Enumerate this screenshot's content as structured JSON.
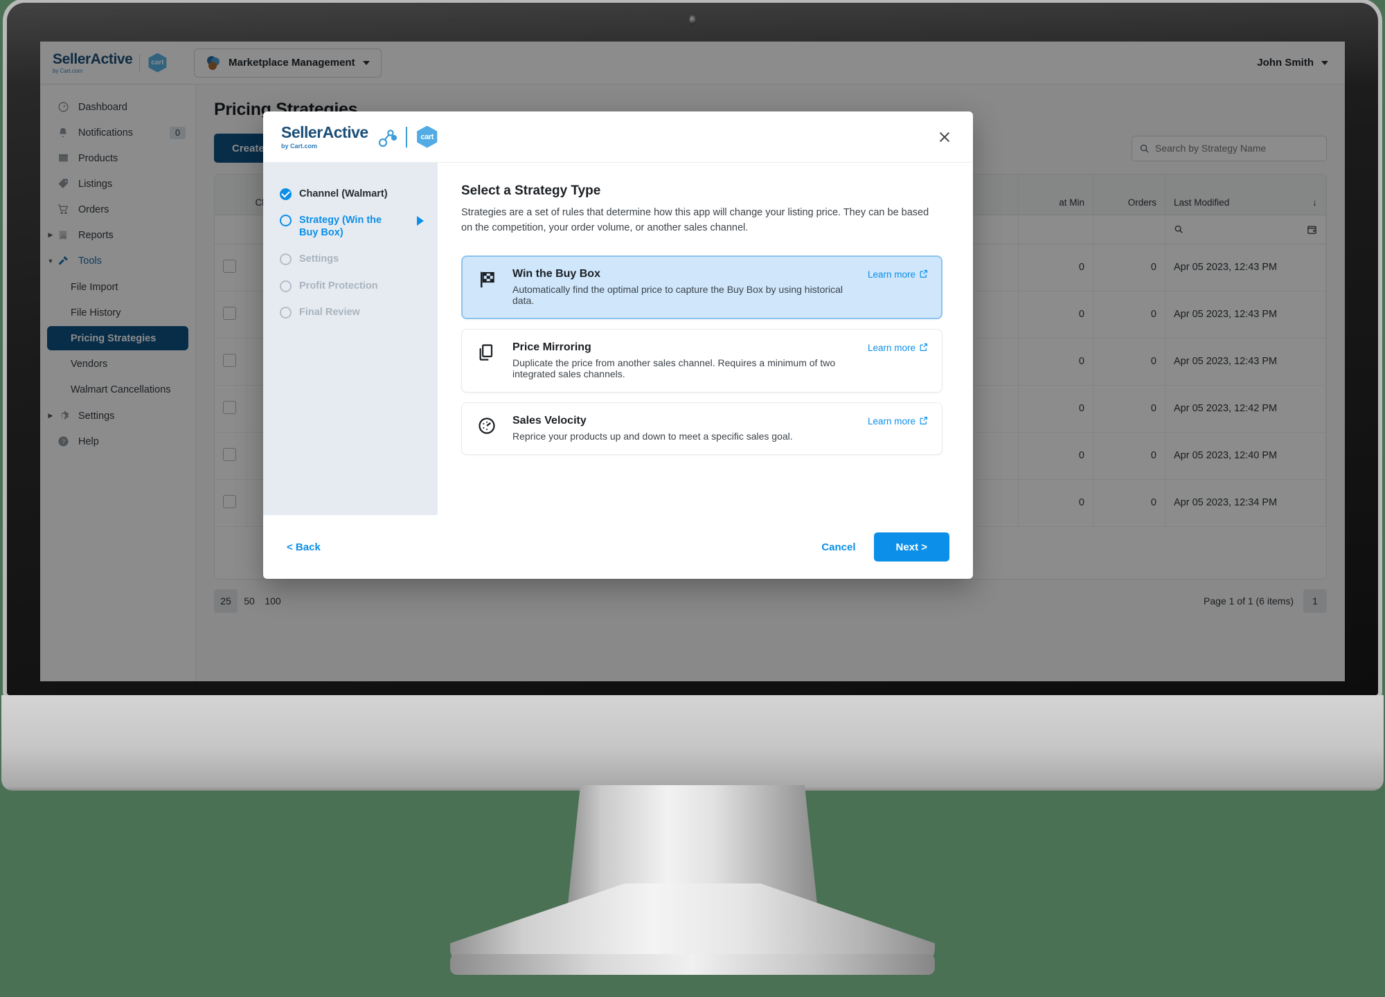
{
  "app": {
    "brand_name": "SellerActive",
    "brand_tagline": "by Cart.com",
    "cart_badge": "cart",
    "workspace": "Marketplace Management",
    "user_name": "John Smith"
  },
  "sidebar": {
    "items": [
      {
        "label": "Dashboard",
        "icon": "speedometer-icon",
        "type": "item"
      },
      {
        "label": "Notifications",
        "icon": "bell-icon",
        "type": "item",
        "badge": "0"
      },
      {
        "label": "Products",
        "icon": "box-icon",
        "type": "item"
      },
      {
        "label": "Listings",
        "icon": "tag-icon",
        "type": "item"
      },
      {
        "label": "Orders",
        "icon": "cart-icon",
        "type": "item"
      },
      {
        "label": "Reports",
        "icon": "chart-icon",
        "type": "expandable",
        "expanded": false
      },
      {
        "label": "Tools",
        "icon": "tools-icon",
        "type": "expandable",
        "expanded": true
      },
      {
        "label": "File Import",
        "type": "sub"
      },
      {
        "label": "File History",
        "type": "sub"
      },
      {
        "label": "Pricing Strategies",
        "type": "sub",
        "selected": true
      },
      {
        "label": "Vendors",
        "type": "sub"
      },
      {
        "label": "Walmart Cancellations",
        "type": "sub"
      },
      {
        "label": "Settings",
        "icon": "gear-icon",
        "type": "expandable",
        "expanded": false
      },
      {
        "label": "Help",
        "icon": "question-icon",
        "type": "item"
      }
    ]
  },
  "main": {
    "page_title": "Pricing Strategies",
    "create_button": "Create",
    "search_placeholder": "Search by Strategy Name",
    "table": {
      "columns": [
        "",
        "Channel",
        "at Min",
        "Orders",
        "Last Modified"
      ],
      "rows": [
        {
          "at_min": "0",
          "orders": "0",
          "last_modified": "Apr 05 2023, 12:43 PM"
        },
        {
          "at_min": "0",
          "orders": "0",
          "last_modified": "Apr 05 2023, 12:43 PM"
        },
        {
          "at_min": "0",
          "orders": "0",
          "last_modified": "Apr 05 2023, 12:43 PM"
        },
        {
          "at_min": "0",
          "orders": "0",
          "last_modified": "Apr 05 2023, 12:42 PM"
        },
        {
          "at_min": "0",
          "orders": "0",
          "last_modified": "Apr 05 2023, 12:40 PM"
        },
        {
          "at_min": "0",
          "orders": "0",
          "last_modified": "Apr 05 2023, 12:34 PM"
        }
      ]
    },
    "pagination": {
      "sizes": [
        "25",
        "50",
        "100"
      ],
      "selected_size": "25",
      "info": "Page 1 of 1 (6 items)",
      "current_page": "1"
    }
  },
  "modal": {
    "brand_name": "SellerActive",
    "brand_tagline": "by Cart.com",
    "cart_badge": "cart",
    "close_label": "✕",
    "steps": [
      {
        "label": "Channel (Walmart)",
        "state": "done"
      },
      {
        "label": "Strategy (Win the Buy Box)",
        "state": "current"
      },
      {
        "label": "Settings",
        "state": "future"
      },
      {
        "label": "Profit Protection",
        "state": "future"
      },
      {
        "label": "Final Review",
        "state": "future"
      }
    ],
    "panel_title": "Select a Strategy Type",
    "panel_desc": "Strategies are a set of rules that determine how this app will change your listing price. They can be based on the competition, your order volume, or another sales channel.",
    "learn_more_label": "Learn more",
    "cards": [
      {
        "title": "Win the Buy Box",
        "desc": "Automatically find the optimal price to capture the Buy Box by using historical data.",
        "icon": "checkered-flag-icon",
        "selected": true
      },
      {
        "title": "Price Mirroring",
        "desc": "Duplicate the price from another sales channel. Requires a minimum of two integrated sales channels.",
        "icon": "copy-icon",
        "selected": false
      },
      {
        "title": "Sales Velocity",
        "desc": "Reprice your products up and down to meet a specific sales goal.",
        "icon": "gauge-icon",
        "selected": false
      }
    ],
    "back_label": "< Back",
    "cancel_label": "Cancel",
    "next_label": "Next >"
  },
  "colors": {
    "accent_blue": "#0b8fe8",
    "dark_blue": "#0e5286",
    "selected_card_bg": "#cfe6fb",
    "step_panel_bg": "#e6ebf2",
    "desktop_bg": "#4a7153"
  }
}
